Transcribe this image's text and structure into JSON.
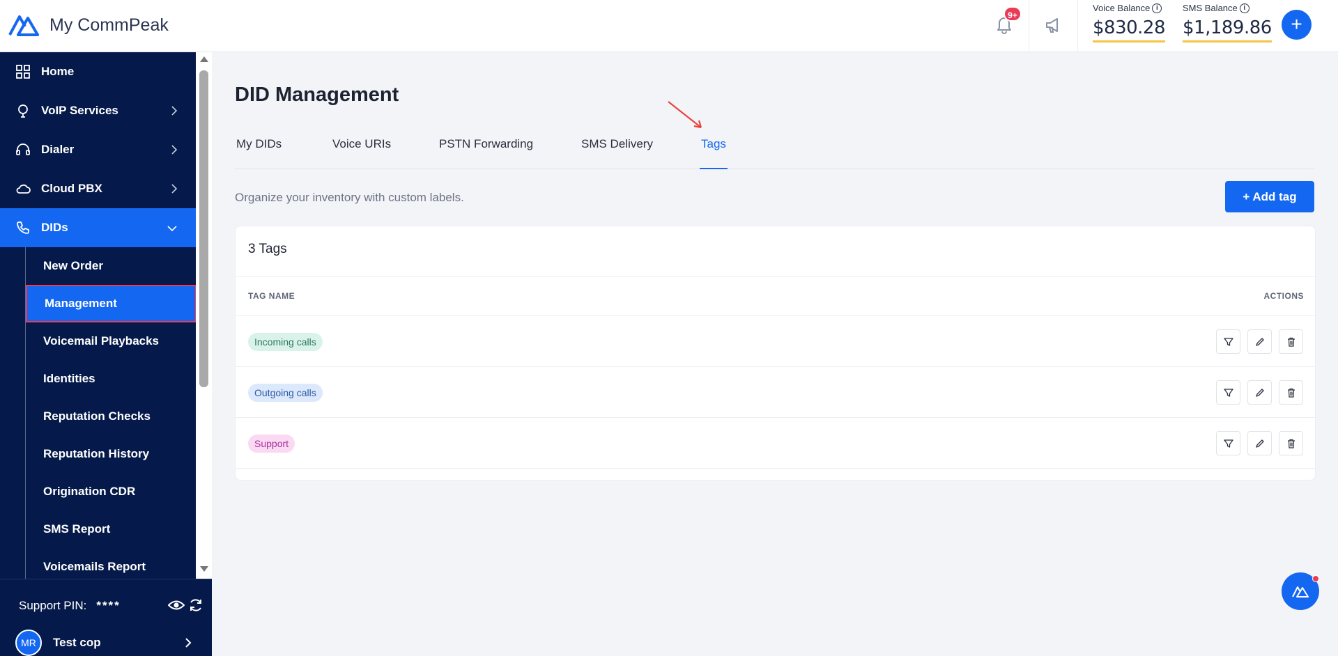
{
  "brand": {
    "name": "My CommPeak"
  },
  "header": {
    "notifications_badge": "9+",
    "voice_balance": {
      "label": "Voice Balance",
      "value": "$830.28"
    },
    "sms_balance": {
      "label": "SMS Balance",
      "value": "$1,189.86"
    },
    "info_glyph": "i",
    "plus_glyph": "+"
  },
  "sidebar": {
    "items": [
      {
        "label": "Home",
        "icon": "grid-icon"
      },
      {
        "label": "VoIP Services",
        "icon": "voip-icon"
      },
      {
        "label": "Dialer",
        "icon": "headset-icon"
      },
      {
        "label": "Cloud PBX",
        "icon": "cloud-icon"
      },
      {
        "label": "DIDs",
        "icon": "phone-icon"
      }
    ],
    "sub_items": [
      "New Order",
      "Management",
      "Voicemail Playbacks",
      "Identities",
      "Reputation Checks",
      "Reputation History",
      "Origination CDR",
      "SMS Report",
      "Voicemails Report"
    ],
    "footer": {
      "pin_label": "Support PIN:",
      "pin_value": "****",
      "avatar_initials": "MR",
      "user_name": "Test cop"
    }
  },
  "main": {
    "title": "DID Management",
    "tabs": [
      "My DIDs",
      "Voice URIs",
      "PSTN Forwarding",
      "SMS Delivery",
      "Tags"
    ],
    "active_tab": "Tags",
    "description": "Organize your inventory with custom labels.",
    "add_button": "+ Add tag",
    "card": {
      "count": "3 Tags",
      "col_tag": "TAG NAME",
      "col_actions": "ACTIONS",
      "rows": [
        {
          "name": "Incoming calls",
          "bg": "#d9f2ea",
          "fg": "#2f7a5c"
        },
        {
          "name": "Outgoing calls",
          "bg": "#dce8fb",
          "fg": "#2d5aa8"
        },
        {
          "name": "Support",
          "bg": "#fbd9f3",
          "fg": "#a3319b"
        }
      ]
    }
  },
  "colors": {
    "accent": "#1467f0",
    "sidebar": "#051a4a",
    "badge": "#ea3b57",
    "balance_underline": "#f5c542"
  }
}
